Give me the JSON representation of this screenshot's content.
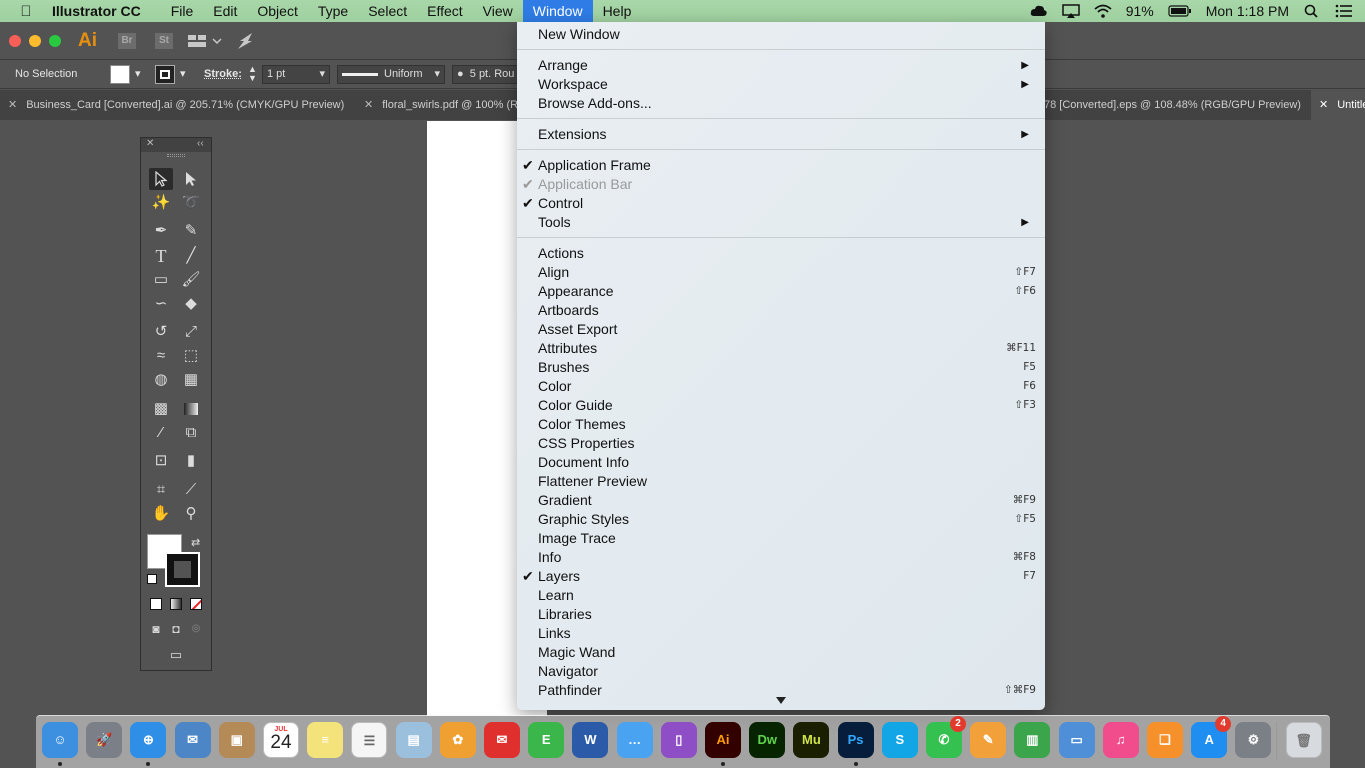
{
  "menubar": {
    "app_name": "Illustrator CC",
    "menus": [
      "File",
      "Edit",
      "Object",
      "Type",
      "Select",
      "Effect",
      "View",
      "Window",
      "Help"
    ],
    "battery": "91%",
    "clock": "Mon 1:18 PM"
  },
  "titlebar": {
    "logo": "Ai",
    "bridge": "Br",
    "stock": "St"
  },
  "controlbar": {
    "selection": "No Selection",
    "stroke_label": "Stroke:",
    "stroke_weight": "1 pt",
    "profile": "Uniform",
    "brush": "5 pt. Rou"
  },
  "tabs": [
    "Business_Card [Converted].ai @ 205.71% (CMYK/GPU Preview)",
    "floral_swirls.pdf @ 100% (R",
    "78 [Converted].eps @ 108.48% (RGB/GPU Preview)",
    "Untitle"
  ],
  "window_menu": {
    "items": [
      {
        "label": "New Window"
      },
      {
        "label": "Arrange",
        "submenu": true
      },
      {
        "label": "Workspace",
        "submenu": true
      },
      {
        "label": "Browse Add-ons..."
      },
      {
        "label": "Extensions",
        "submenu": true
      },
      {
        "label": "Application Frame",
        "checked": true
      },
      {
        "label": "Application Bar",
        "checked": true,
        "disabled": true
      },
      {
        "label": "Control",
        "checked": true
      },
      {
        "label": "Tools",
        "submenu": true
      },
      {
        "label": "Actions"
      },
      {
        "label": "Align",
        "shortcut": "⇧F7"
      },
      {
        "label": "Appearance",
        "shortcut": "⇧F6"
      },
      {
        "label": "Artboards"
      },
      {
        "label": "Asset Export"
      },
      {
        "label": "Attributes",
        "shortcut": "⌘F11"
      },
      {
        "label": "Brushes",
        "shortcut": "F5"
      },
      {
        "label": "Color",
        "shortcut": "F6"
      },
      {
        "label": "Color Guide",
        "shortcut": "⇧F3"
      },
      {
        "label": "Color Themes"
      },
      {
        "label": "CSS Properties"
      },
      {
        "label": "Document Info"
      },
      {
        "label": "Flattener Preview"
      },
      {
        "label": "Gradient",
        "shortcut": "⌘F9"
      },
      {
        "label": "Graphic Styles",
        "shortcut": "⇧F5"
      },
      {
        "label": "Image Trace"
      },
      {
        "label": "Info",
        "shortcut": "⌘F8"
      },
      {
        "label": "Layers",
        "checked": true,
        "shortcut": "F7"
      },
      {
        "label": "Learn"
      },
      {
        "label": "Libraries"
      },
      {
        "label": "Links"
      },
      {
        "label": "Magic Wand"
      },
      {
        "label": "Navigator"
      },
      {
        "label": "Pathfinder",
        "shortcut": "⇧⌘F9"
      }
    ]
  },
  "dock": {
    "calendar_month": "JUL",
    "calendar_day": "24",
    "facetime_badge": "2",
    "appstore_badge": "4",
    "apps": [
      {
        "name": "finder-icon",
        "color": "#3d8fe0",
        "glyph": "☺",
        "running": true
      },
      {
        "name": "launchpad-icon",
        "color": "#7a7f88",
        "glyph": "🚀"
      },
      {
        "name": "safari-icon",
        "color": "#2f8fe6",
        "glyph": "⊕",
        "running": true
      },
      {
        "name": "mail-stamp-icon",
        "color": "#4c86c7",
        "glyph": "✉"
      },
      {
        "name": "contacts-icon",
        "color": "#b48a56",
        "glyph": "▣"
      },
      {
        "name": "calendar-icon",
        "color": "#ffffff",
        "glyph": ""
      },
      {
        "name": "notes-icon",
        "color": "#f4e27a",
        "glyph": "≡"
      },
      {
        "name": "reminders-icon",
        "color": "#f5f5f5",
        "glyph": "☰"
      },
      {
        "name": "preview-icon",
        "color": "#9bc0de",
        "glyph": "▤"
      },
      {
        "name": "photos-icon",
        "color": "#f0a030",
        "glyph": "✿"
      },
      {
        "name": "airmail-icon",
        "color": "#e0302e",
        "glyph": "✉"
      },
      {
        "name": "evernote-icon",
        "color": "#3bb64a",
        "glyph": "E"
      },
      {
        "name": "word-icon",
        "color": "#2b5aa8",
        "glyph": "W"
      },
      {
        "name": "messages-icon",
        "color": "#4aa3f0",
        "glyph": "…"
      },
      {
        "name": "ibooks-author-icon",
        "color": "#8e4ec6",
        "glyph": "▯"
      },
      {
        "name": "illustrator-icon",
        "color": "#330000",
        "glyph": "Ai",
        "text_color": "#ff9a00",
        "running": true
      },
      {
        "name": "dreamweaver-icon",
        "color": "#072401",
        "glyph": "Dw",
        "text_color": "#5fd34b"
      },
      {
        "name": "muse-icon",
        "color": "#1b1f02",
        "glyph": "Mu",
        "text_color": "#d0e34a"
      },
      {
        "name": "photoshop-icon",
        "color": "#061e3c",
        "glyph": "Ps",
        "text_color": "#32a8ff",
        "running": true
      },
      {
        "name": "skype-icon",
        "color": "#12a6e6",
        "glyph": "S"
      },
      {
        "name": "facetime-icon",
        "color": "#35c14f",
        "glyph": "✆"
      },
      {
        "name": "pages-icon",
        "color": "#f2a03a",
        "glyph": "✎"
      },
      {
        "name": "numbers-icon",
        "color": "#3aa54a",
        "glyph": "▥"
      },
      {
        "name": "keynote-icon",
        "color": "#4f8fd8",
        "glyph": "▭"
      },
      {
        "name": "itunes-icon",
        "color": "#f14d8d",
        "glyph": "♫"
      },
      {
        "name": "ibooks-icon",
        "color": "#f5902b",
        "glyph": "❑"
      },
      {
        "name": "appstore-icon",
        "color": "#1f8ef1",
        "glyph": "A"
      },
      {
        "name": "system-preferences-icon",
        "color": "#7b7f86",
        "glyph": "⚙"
      },
      {
        "name": "trash-icon",
        "color": "#d7dbe0",
        "glyph": "🗑",
        "text_color": "#777"
      }
    ]
  }
}
